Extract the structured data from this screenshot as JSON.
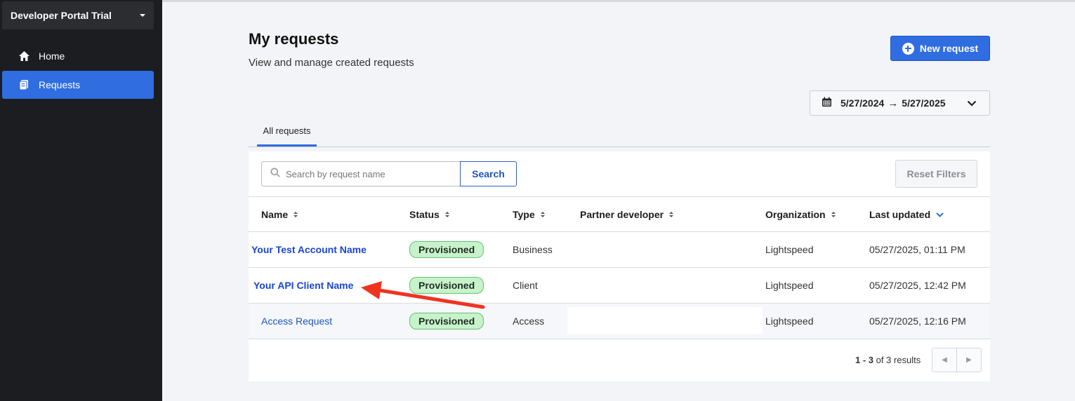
{
  "sidebar": {
    "portal_name": "Developer Portal Trial",
    "items": [
      {
        "label": "Home",
        "icon": "home-icon"
      },
      {
        "label": "Requests",
        "icon": "requests-icon",
        "active": true
      }
    ]
  },
  "header": {
    "title": "My requests",
    "subtitle": "View and manage created requests",
    "new_request_label": "New request"
  },
  "date_range": {
    "start": "5/27/2024",
    "arrow": "→",
    "end": "5/27/2025"
  },
  "tabs": [
    {
      "label": "All requests",
      "active": true
    }
  ],
  "search": {
    "placeholder": "Search by request name",
    "value": "",
    "button_label": "Search"
  },
  "reset_filters_label": "Reset Filters",
  "table": {
    "columns": [
      "Name",
      "Status",
      "Type",
      "Partner developer",
      "Organization",
      "Last updated"
    ],
    "sorted_column": "Last updated",
    "rows": [
      {
        "name": "Your Test Account Name",
        "status": "Provisioned",
        "type": "Business",
        "partner_developer": "",
        "organization": "Lightspeed",
        "last_updated": "05/27/2025, 01:11 PM"
      },
      {
        "name": "Your API Client Name",
        "status": "Provisioned",
        "type": "Client",
        "partner_developer": "",
        "organization": "Lightspeed",
        "last_updated": "05/27/2025, 12:42 PM"
      },
      {
        "name": "Access Request",
        "status": "Provisioned",
        "type": "Access",
        "partner_developer": "",
        "organization": "Lightspeed",
        "last_updated": "05/27/2025, 12:16 PM"
      }
    ]
  },
  "pagination": {
    "range": "1 - 3",
    "suffix": "of 3 results"
  },
  "colors": {
    "accent": "#2f6de1",
    "sidebar_bg": "#1b1d21",
    "badge_bg": "#c7f2cc",
    "annotation_arrow": "#f0331f"
  }
}
